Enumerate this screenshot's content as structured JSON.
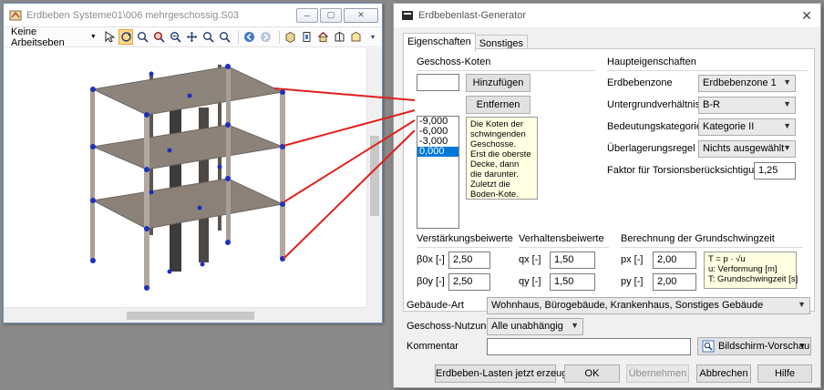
{
  "viewer": {
    "title": "Erdbeben Systeme01\\006 mehrgeschossig.S03",
    "toolbar_dropdown": "Keine Arbeitseben",
    "minimize_glyph": "─",
    "maximize_glyph": "▢",
    "close_glyph": "✕"
  },
  "dialog": {
    "title": "Erdbebenlast-Generator",
    "close_glyph": "✕",
    "tabs": [
      "Eigenschaften",
      "Sonstiges"
    ],
    "geschoss_koten": {
      "heading": "Geschoss-Koten",
      "new_value": "",
      "add_button": "Hinzufügen",
      "remove_button": "Entfernen",
      "items": [
        "-9,000",
        "-6,000",
        "-3,000",
        "0,000"
      ],
      "selected_index": 3,
      "note_lines": [
        "Die Koten der",
        "schwingenden",
        "Geschosse.",
        "Erst die oberste",
        "Decke, dann",
        "die darunter.",
        "Zuletzt die",
        "Boden-Kote."
      ]
    },
    "haupteigenschaften": {
      "heading": "Haupteigenschaften",
      "erdbebenzone_label": "Erdbebenzone",
      "erdbebenzone_value": "Erdbebenzone 1",
      "untergrund_label": "Untergrundverhältnisse",
      "untergrund_value": "B-R",
      "bedeutung_label": "Bedeutungskategorie",
      "bedeutung_value": "Kategorie II",
      "ueberlagerung_label": "Überlagerungsregel",
      "ueberlagerung_value": "Nichts ausgewählt",
      "torsion_label": "Faktor für Torsionsberücksichtigung [-]",
      "torsion_value": "1,25"
    },
    "verstaerkung": {
      "heading": "Verstärkungsbeiwerte",
      "b0x_label": "β0x [-]",
      "b0x_value": "2,50",
      "b0y_label": "β0y [-]",
      "b0y_value": "2,50"
    },
    "verhalten": {
      "heading": "Verhaltensbeiwerte",
      "qx_label": "qx [-]",
      "qx_value": "1,50",
      "qy_label": "qy [-]",
      "qy_value": "1,50"
    },
    "grundschwingzeit": {
      "heading": "Berechnung der Grundschwingzeit",
      "px_label": "px [-]",
      "px_value": "2,00",
      "py_label": "py [-]",
      "py_value": "2,00",
      "note_lines": [
        "T = p · √u",
        "u: Verformung [m]",
        "T: Grundschwingzeit [s]"
      ]
    },
    "gebaeude_art_label": "Gebäude-Art",
    "gebaeude_art_value": "Wohnhaus, Bürogebäude, Krankenhaus, Sonstiges Gebäude",
    "geschoss_nutzung_label": "Geschoss-Nutzung",
    "geschoss_nutzung_value": "Alle unabhängig",
    "kommentar_label": "Kommentar",
    "kommentar_value": "",
    "preview_button": "Bildschirm-Vorschau",
    "buttons": {
      "generate": "Erdbeben-Lasten jetzt erzeugen",
      "ok": "OK",
      "apply": "Übernehmen",
      "cancel": "Abbrechen",
      "help": "Hilfe"
    }
  },
  "colors": {
    "slab": "#8b8178",
    "node": "#1f2fbf",
    "callout": "#e0201c",
    "selection": "#0078d7"
  }
}
